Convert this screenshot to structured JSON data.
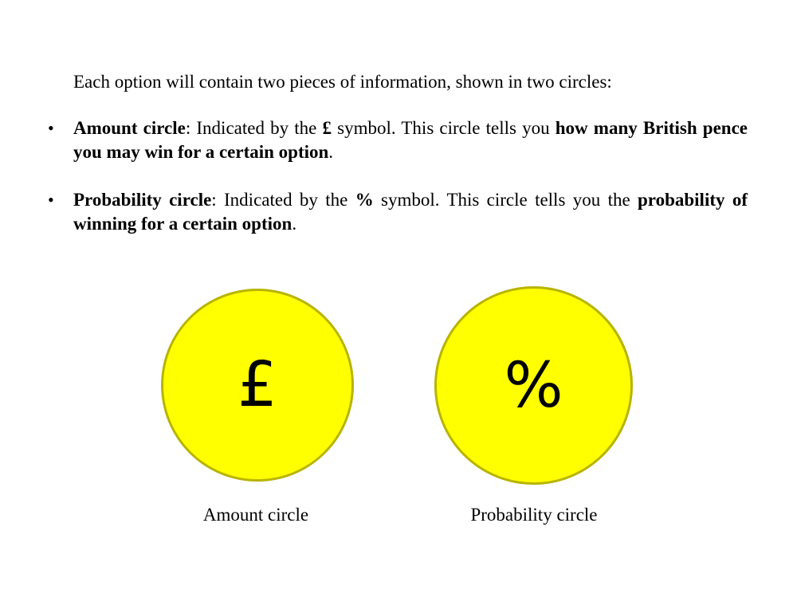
{
  "intro": "Each option will contain two pieces of information, shown in two circles:",
  "bullets": [
    {
      "bullet_char": "•",
      "term": "Amount circle",
      "text_1": ": Indicated by the ",
      "symbol": "£",
      "text_2": " symbol. This circle tells you ",
      "emphasis": "how many British pence you may win for a certain option",
      "text_3": "."
    },
    {
      "bullet_char": "•",
      "term": "Probability circle",
      "text_1": ": Indicated by the ",
      "symbol": "%",
      "text_2": " symbol. This circle tells you the ",
      "emphasis": "probability of winning for a certain option",
      "text_3": "."
    }
  ],
  "circles": {
    "amount": {
      "symbol": "£",
      "label": "Amount circle",
      "fill_color": "#ffff00",
      "border_color": "#b8b400"
    },
    "probability": {
      "symbol": "%",
      "label": "Probability circle",
      "fill_color": "#ffff00",
      "border_color": "#b8b400"
    }
  }
}
